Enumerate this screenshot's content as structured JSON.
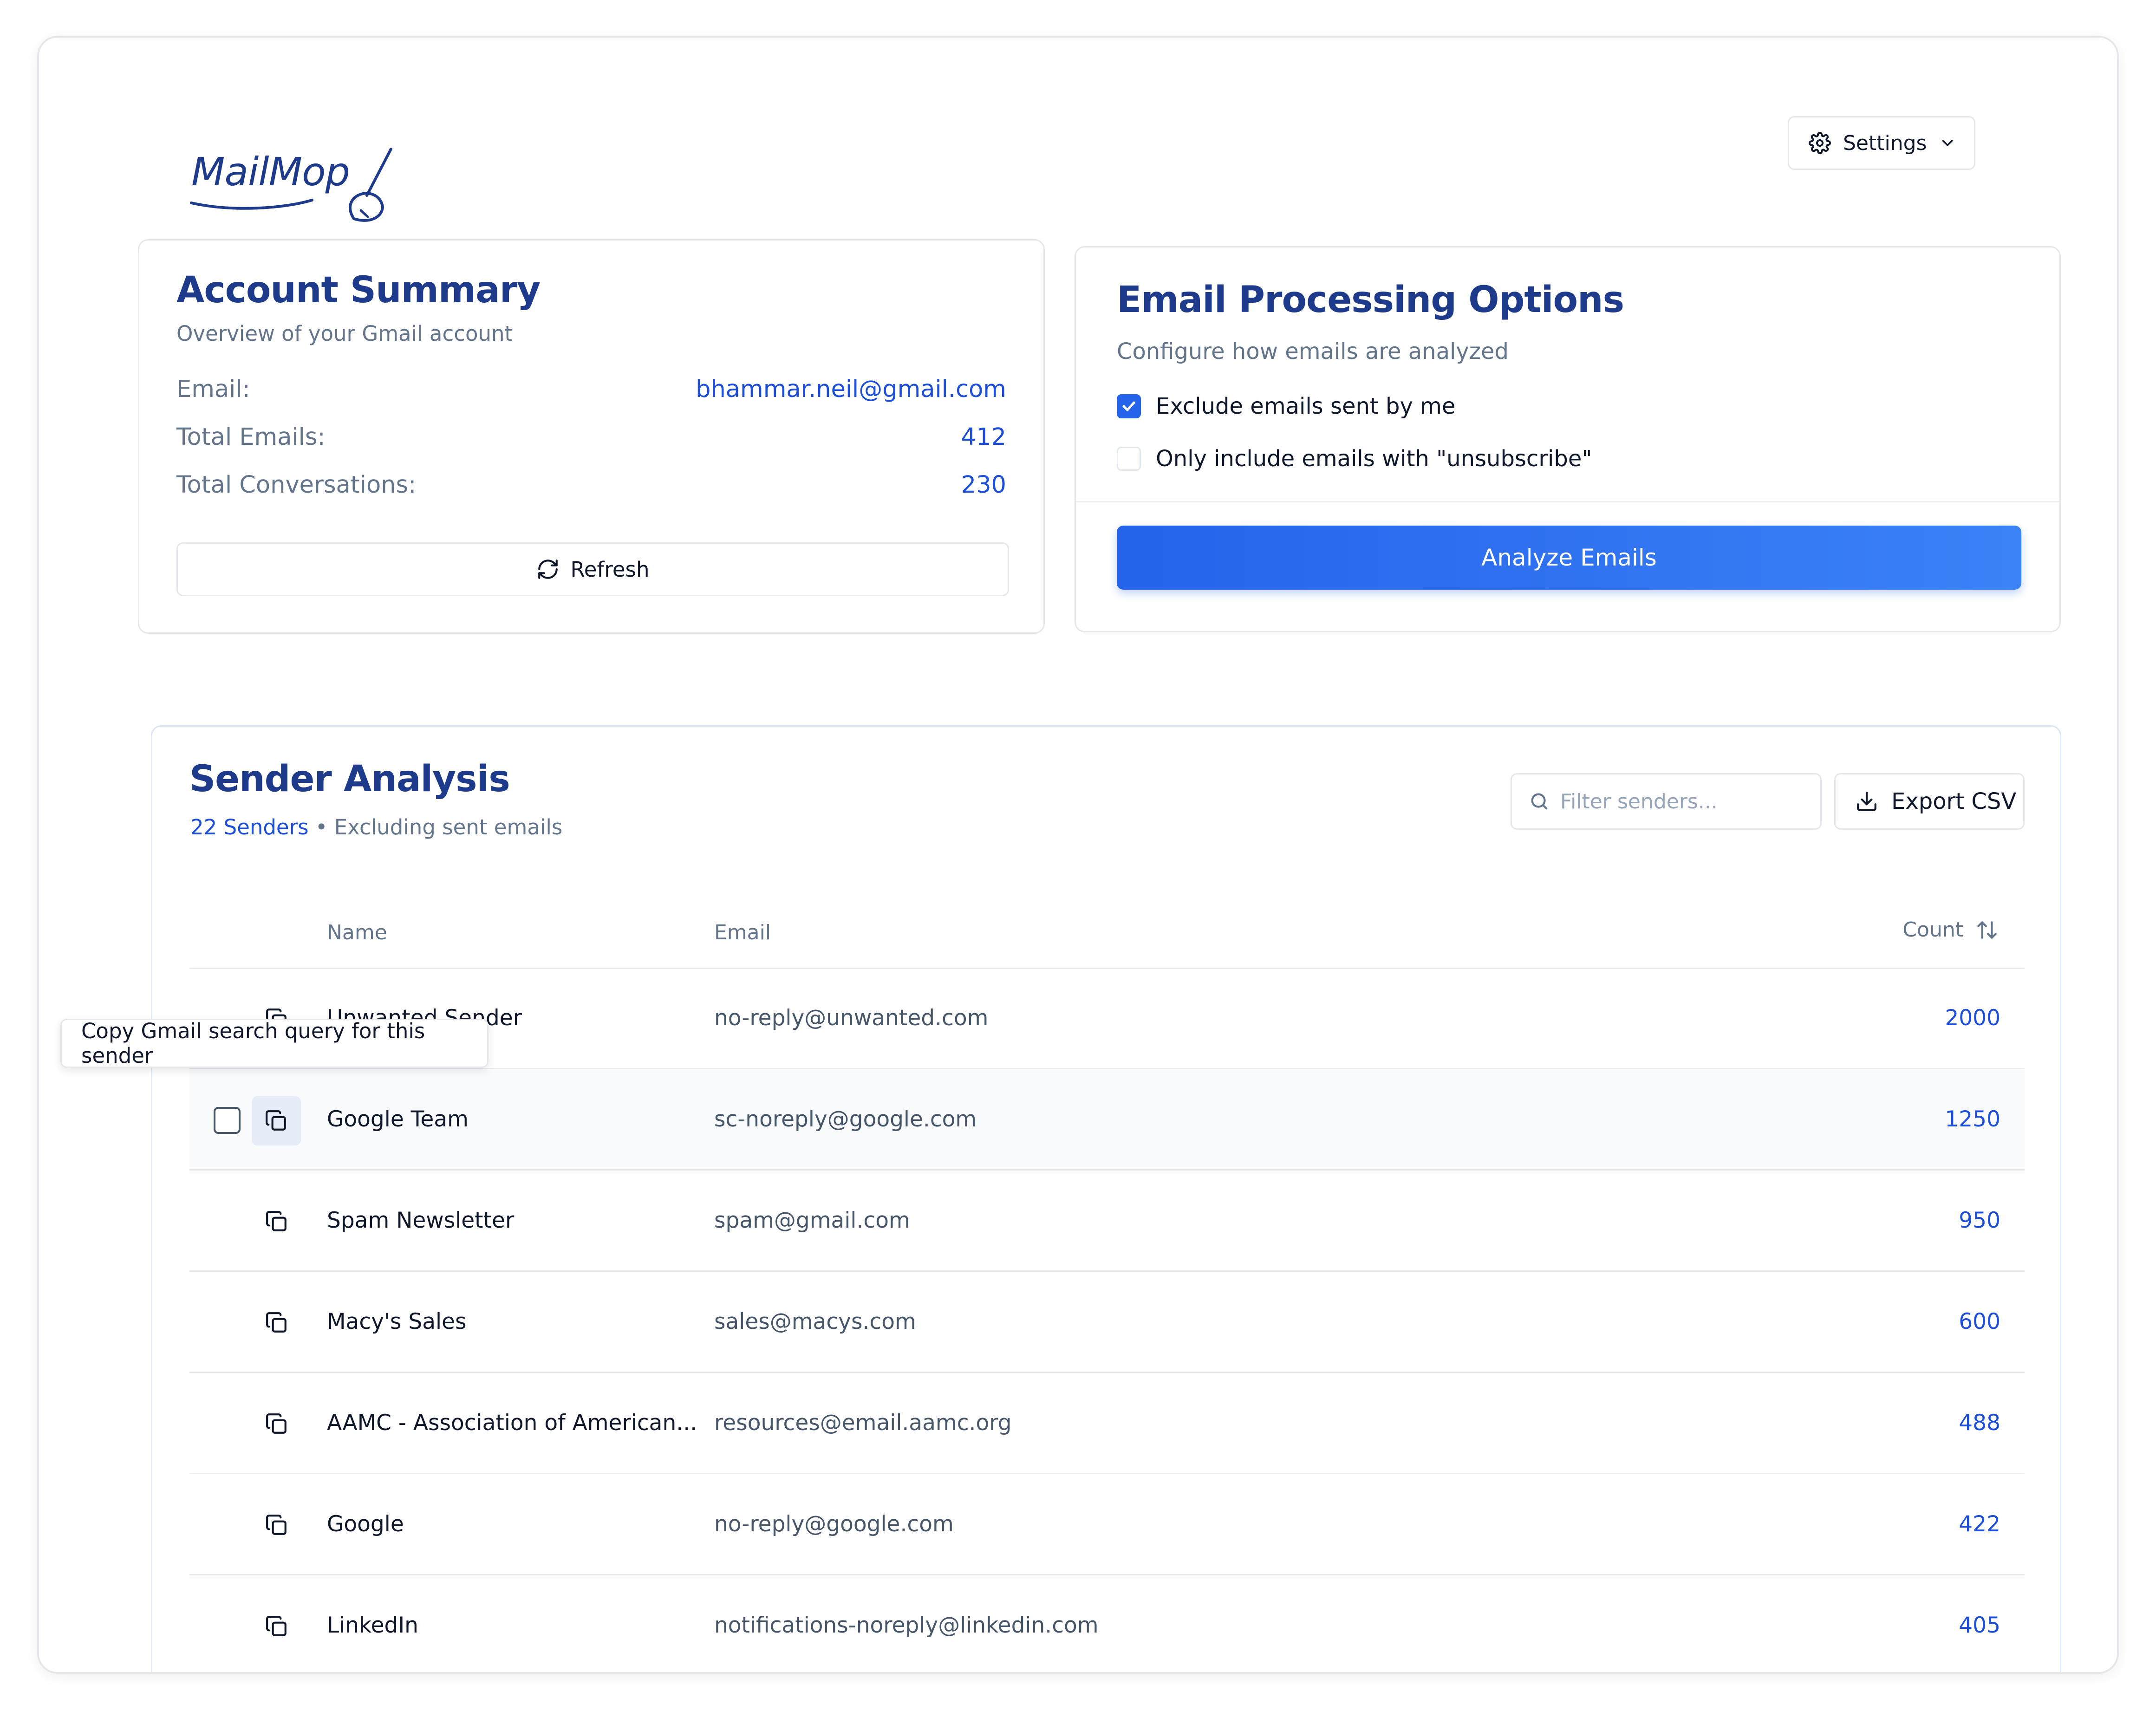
{
  "app": {
    "logo_text": "MailMop"
  },
  "header": {
    "settings_label": "Settings"
  },
  "account_summary": {
    "title": "Account Summary",
    "subtitle": "Overview of your Gmail account",
    "rows": [
      {
        "label": "Email:",
        "value": "bhammar.neil@gmail.com"
      },
      {
        "label": "Total Emails:",
        "value": "412"
      },
      {
        "label": "Total Conversations:",
        "value": "230"
      }
    ],
    "refresh_label": "Refresh"
  },
  "processing_options": {
    "title": "Email Processing Options",
    "subtitle": "Configure how emails are analyzed",
    "options": [
      {
        "label": "Exclude emails sent by me",
        "checked": true
      },
      {
        "label": "Only include emails with \"unsubscribe\"",
        "checked": false
      }
    ],
    "analyze_label": "Analyze Emails"
  },
  "sender_analysis": {
    "title": "Sender Analysis",
    "sender_count": "22 Senders",
    "meta_separator": "•",
    "meta_note": "Excluding sent emails",
    "filter_placeholder": "Filter senders...",
    "export_label": "Export CSV",
    "columns": {
      "name": "Name",
      "email": "Email",
      "count": "Count"
    },
    "rows": [
      {
        "name": "Unwanted Sender",
        "email": "no-reply@unwanted.com",
        "count": "2000"
      },
      {
        "name": "Google Team",
        "email": "sc-noreply@google.com",
        "count": "1250"
      },
      {
        "name": "Spam Newsletter",
        "email": "spam@gmail.com",
        "count": "950"
      },
      {
        "name": "Macy's Sales",
        "email": "sales@macys.com",
        "count": "600"
      },
      {
        "name": "AAMC - Association of American...",
        "email": "resources@email.aamc.org",
        "count": "488"
      },
      {
        "name": "Google",
        "email": "no-reply@google.com",
        "count": "422"
      },
      {
        "name": "LinkedIn",
        "email": "notifications-noreply@linkedin.com",
        "count": "405"
      }
    ],
    "hovered_row": 1
  },
  "tooltip": {
    "text": "Copy Gmail search query for this sender"
  },
  "colors": {
    "accent": "#2563eb",
    "heading": "#1e3a8a",
    "link": "#1d4ed8",
    "muted": "#64748b"
  },
  "icons": [
    "broom-icon",
    "gear-icon",
    "chevron-down-icon",
    "refresh-icon",
    "check-icon",
    "search-icon",
    "download-icon",
    "sort-icon",
    "copy-icon"
  ]
}
